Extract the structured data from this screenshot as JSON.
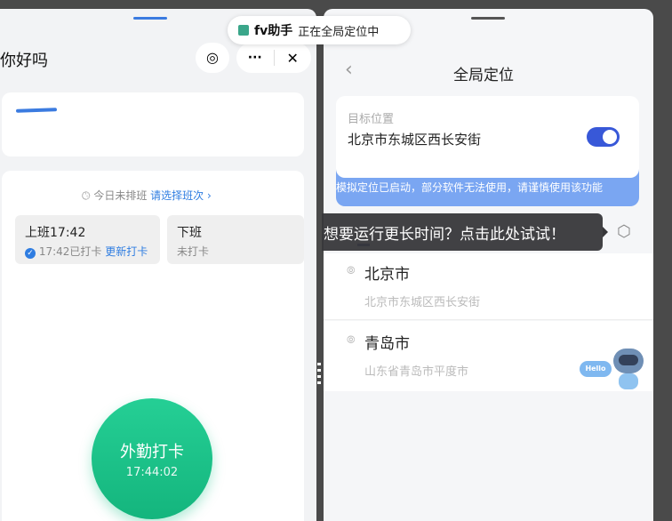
{
  "left_app": {
    "title": "你好吗",
    "schedule_text": "今日未排班",
    "schedule_link": "请选择班次",
    "shift_in": {
      "label": "上班17:42",
      "status": "17:42已打卡",
      "action": "更新打卡"
    },
    "shift_out": {
      "label": "下班",
      "status": "未打卡"
    },
    "punch_button": {
      "label": "外勤打卡",
      "time": "17:44:02"
    }
  },
  "toast": {
    "app": "fv助手",
    "message": "正在全局定位中"
  },
  "right_app": {
    "title": "全局定位",
    "target_label": "目标位置",
    "target_value": "北京市东城区西长安街",
    "toggle_on": true,
    "warning": "模拟定位已启动，部分软件无法使用，请谨慎使用该功能",
    "tooltip": "想要运行更长时间？点击此处试试！",
    "locations": [
      {
        "name": "北京市",
        "address": "北京市东城区西长安街"
      },
      {
        "name": "青岛市",
        "address": "山东省青岛市平度市"
      }
    ],
    "robot_text": "Hello"
  },
  "colors": {
    "accent": "#3858d8",
    "green": "#1ec38a",
    "link": "#2f7de1"
  }
}
